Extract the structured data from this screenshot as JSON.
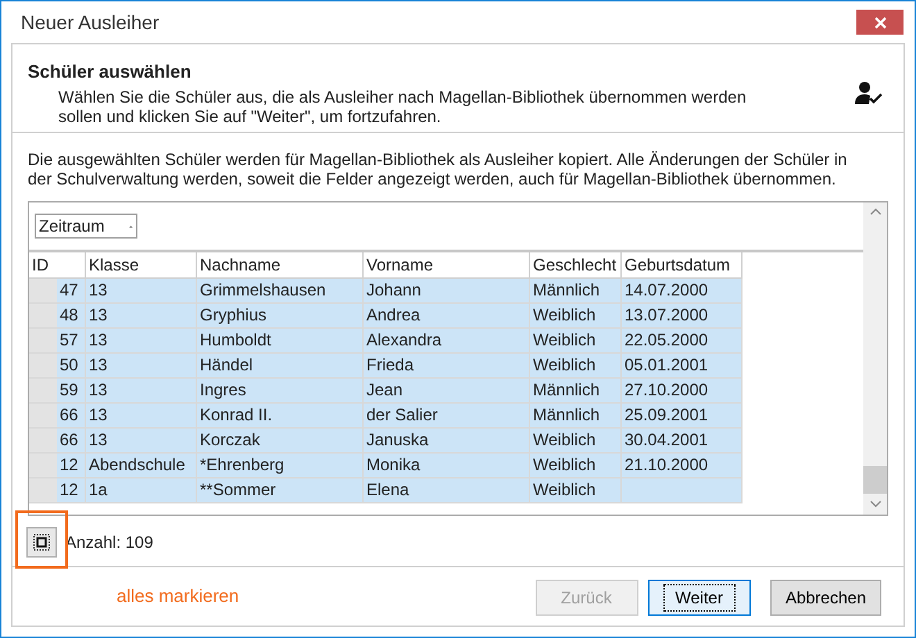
{
  "window": {
    "title": "Neuer Ausleiher"
  },
  "header": {
    "title": "Schüler auswählen",
    "text": "Wählen Sie die Schüler aus, die als Ausleiher nach Magellan-Bibliothek übernommen werden sollen und klicken Sie auf \"Weiter\", um fortzufahren."
  },
  "description": "Die ausgewählten Schüler werden für Magellan-Bibliothek als Ausleiher kopiert. Alle Änderungen der Schüler in der Schulverwaltung werden, soweit die Felder angezeigt werden, auch für Magellan-Bibliothek übernommen.",
  "group_panel": {
    "label": "Zeitraum"
  },
  "table": {
    "columns": [
      "ID",
      "Klasse",
      "Nachname",
      "Vorname",
      "Geschlecht",
      "Geburtsdatum"
    ],
    "rows": [
      {
        "cells": [
          "47",
          "13",
          "Grimmelshausen",
          "Johann",
          "Männlich",
          "14.07.2000"
        ],
        "selected": true
      },
      {
        "cells": [
          "48",
          "13",
          "Gryphius",
          "Andrea",
          "Weiblich",
          "13.07.2000"
        ],
        "selected": true
      },
      {
        "cells": [
          "57",
          "13",
          "Humboldt",
          "Alexandra",
          "Weiblich",
          "22.05.2000"
        ],
        "selected": true
      },
      {
        "cells": [
          "50",
          "13",
          "Händel",
          "Frieda",
          "Weiblich",
          "05.01.2001"
        ],
        "selected": true
      },
      {
        "cells": [
          "59",
          "13",
          "Ingres",
          "Jean",
          "Männlich",
          "27.10.2000"
        ],
        "selected": true
      },
      {
        "cells": [
          "66",
          "13",
          "Konrad II.",
          "der Salier",
          "Männlich",
          "25.09.2001"
        ],
        "selected": true
      },
      {
        "cells": [
          "66",
          "13",
          "Korczak",
          "Januska",
          "Weiblich",
          "30.04.2001"
        ],
        "selected": true
      },
      {
        "cells": [
          "12",
          "Abendschule",
          "*Ehrenberg",
          "Monika",
          "Weiblich",
          "21.10.2000"
        ],
        "selected": true
      },
      {
        "cells": [
          "12",
          "1a",
          "**Sommer",
          "Elena",
          "Weiblich",
          ""
        ],
        "selected": true
      }
    ]
  },
  "count": "Anzahl: 109",
  "annotation": "alles markieren",
  "buttons": [
    {
      "label": "Zurück",
      "disabled": true,
      "focused": false
    },
    {
      "label": "Weiter",
      "disabled": false,
      "focused": true
    },
    {
      "label": "Abbrechen",
      "disabled": false,
      "focused": false
    }
  ]
}
